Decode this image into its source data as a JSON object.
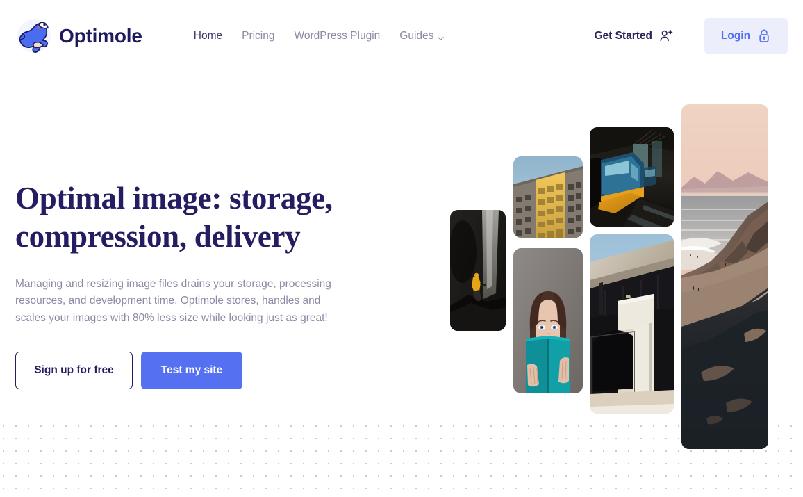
{
  "brand": {
    "name": "Optimole",
    "logo_icon": "mole-mascot-logo",
    "logo_color": "#4a6cf0"
  },
  "nav": {
    "items": [
      {
        "label": "Home",
        "active": true,
        "caret": false
      },
      {
        "label": "Pricing",
        "active": false,
        "caret": false
      },
      {
        "label": "WordPress Plugin",
        "active": false,
        "caret": false
      },
      {
        "label": "Guides",
        "active": false,
        "caret": true,
        "caret_icon": "chevron-down-icon"
      }
    ]
  },
  "header_actions": {
    "get_started": {
      "label": "Get Started",
      "icon": "user-plus-icon"
    },
    "login": {
      "label": "Login",
      "icon": "lock-icon",
      "bg": "#eceefc",
      "color": "#5570f1"
    }
  },
  "hero": {
    "title_line1": "Optimal image: storage,",
    "title_line2": "compression, delivery",
    "title_color": "#241d62",
    "subtitle": "Managing and resizing image files drains your storage, processing resources, and development time. Optimole stores, handles and scales your images with 80% less size while looking just as great!",
    "subtitle_color": "#8b8aa6",
    "buttons": {
      "secondary": {
        "label": "Sign up for free",
        "style": "outline"
      },
      "primary": {
        "label": "Test my site",
        "style": "filled",
        "bg": "#5570f1"
      }
    }
  },
  "collage": {
    "images": [
      {
        "name": "hiker-waterfall-photo",
        "alt": "Person in yellow jacket walking beside a dark waterfall cave"
      },
      {
        "name": "yellow-building-photo",
        "alt": "Upward view of a building facade with yellow painted stripe"
      },
      {
        "name": "woman-reading-photo",
        "alt": "Woman hiding her face behind a teal book"
      },
      {
        "name": "train-station-photo",
        "alt": "Blue and yellow tram at a wet night station platform"
      },
      {
        "name": "overpass-architecture-photo",
        "alt": "Concrete overpass and white building against blue sky"
      },
      {
        "name": "coastal-cliff-photo",
        "alt": "Aerial view of a coastal cliff, beach, road and ocean at dusk"
      }
    ]
  },
  "background": {
    "dot_grid_color": "#c9c9ce"
  }
}
